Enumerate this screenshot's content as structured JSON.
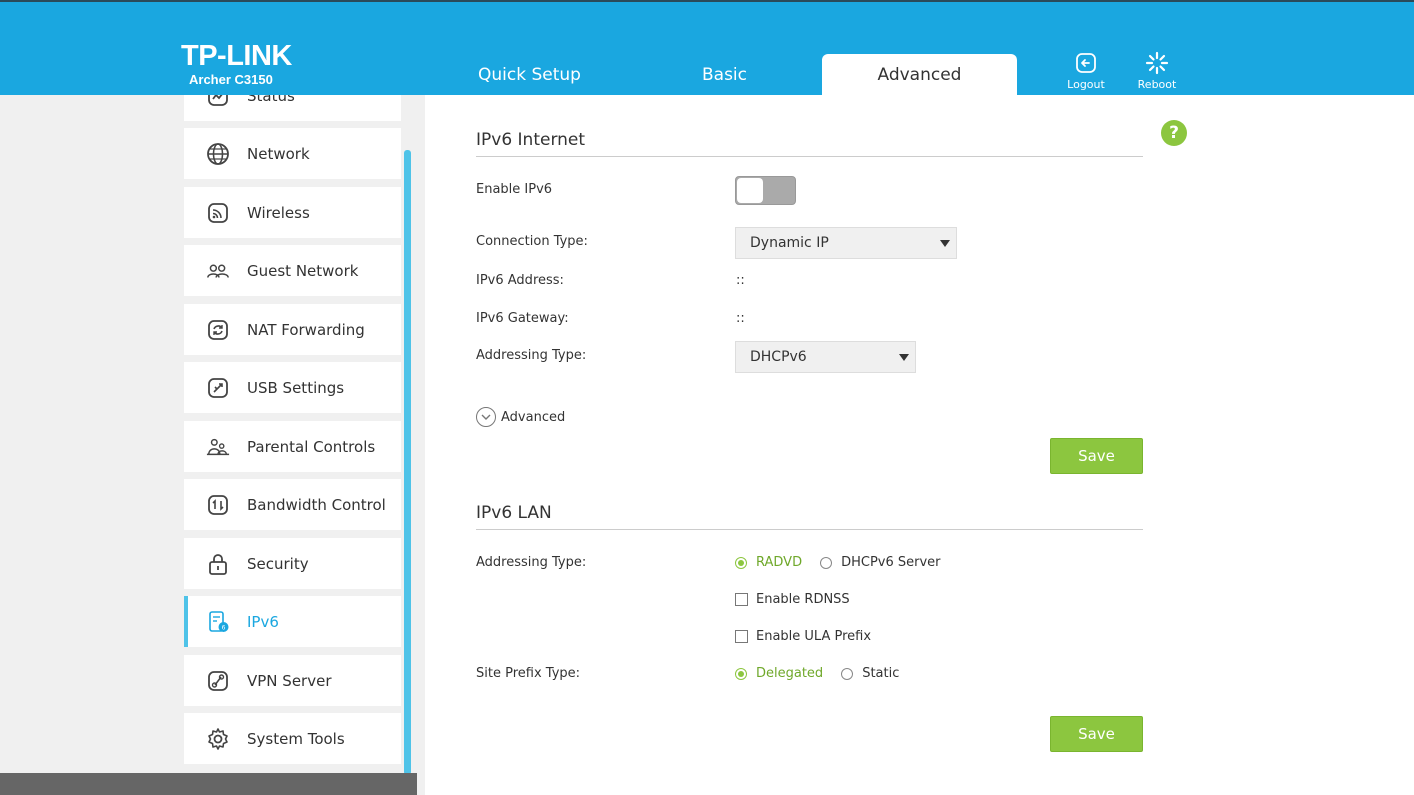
{
  "header": {
    "brand": "TP-LINK",
    "model": "Archer C3150",
    "tabs": [
      {
        "label": "Quick Setup"
      },
      {
        "label": "Basic"
      },
      {
        "label": "Advanced"
      }
    ],
    "logout_label": "Logout",
    "reboot_label": "Reboot"
  },
  "sidebar": {
    "items": [
      {
        "label": "Status",
        "icon": "status-icon"
      },
      {
        "label": "Network",
        "icon": "globe-icon"
      },
      {
        "label": "Wireless",
        "icon": "wireless-icon"
      },
      {
        "label": "Guest Network",
        "icon": "guest-network-icon"
      },
      {
        "label": "NAT Forwarding",
        "icon": "nat-forwarding-icon"
      },
      {
        "label": "USB Settings",
        "icon": "usb-icon"
      },
      {
        "label": "Parental Controls",
        "icon": "parental-controls-icon"
      },
      {
        "label": "Bandwidth Control",
        "icon": "bandwidth-icon"
      },
      {
        "label": "Security",
        "icon": "lock-icon"
      },
      {
        "label": "IPv6",
        "icon": "ipv6-icon"
      },
      {
        "label": "VPN Server",
        "icon": "vpn-icon"
      },
      {
        "label": "System Tools",
        "icon": "gear-icon"
      }
    ],
    "active": "IPv6"
  },
  "help_label": "?",
  "internet": {
    "title": "IPv6 Internet",
    "enable_label": "Enable IPv6",
    "enable_state": "off",
    "connection_type_label": "Connection Type:",
    "connection_type_value": "Dynamic IP",
    "address_label": "IPv6 Address:",
    "address_value": "::",
    "gateway_label": "IPv6 Gateway:",
    "gateway_value": "::",
    "addressing_type_label": "Addressing Type:",
    "addressing_type_value": "DHCPv6",
    "advanced_label": "Advanced",
    "save_label": "Save"
  },
  "lan": {
    "title": "IPv6 LAN",
    "addressing_type_label": "Addressing Type:",
    "addressing_options": [
      {
        "label": "RADVD",
        "selected": true
      },
      {
        "label": "DHCPv6 Server",
        "selected": false
      }
    ],
    "rdnss_label": "Enable RDNSS",
    "ula_label": "Enable ULA Prefix",
    "site_prefix_label": "Site Prefix Type:",
    "site_prefix_options": [
      {
        "label": "Delegated",
        "selected": true
      },
      {
        "label": "Static",
        "selected": false
      }
    ],
    "save_label": "Save"
  },
  "colors": {
    "header_blue": "#1aa7e0",
    "accent_green": "#8cc63f",
    "active_cyan": "#4fc3e8"
  }
}
